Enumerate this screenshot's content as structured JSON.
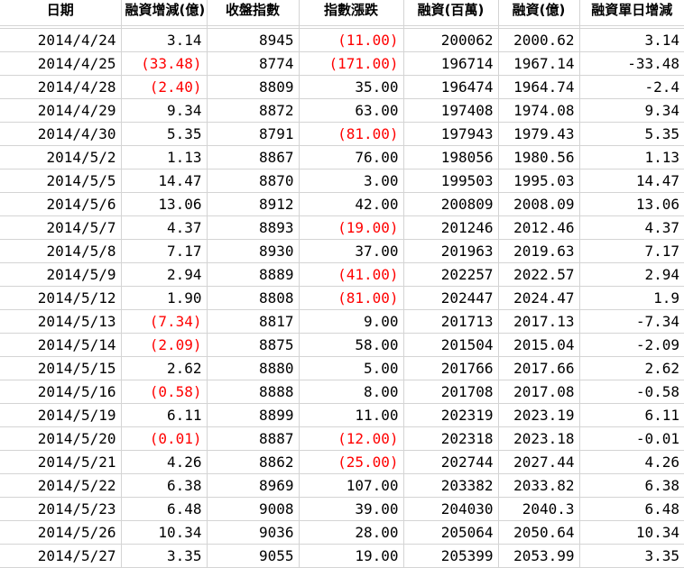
{
  "colors": {
    "negative": "#ff0000",
    "gridline": "#d4d4d4"
  },
  "headers": [
    "日期",
    "融資增減(億)",
    "收盤指數",
    "指數漲跌",
    "融資(百萬)",
    "融資(億)",
    "融資單日增減"
  ],
  "rows": [
    [
      "2014/4/24",
      "3.14",
      "8945",
      "(11.00)",
      "200062",
      "2000.62",
      "3.14"
    ],
    [
      "2014/4/25",
      "(33.48)",
      "8774",
      "(171.00)",
      "196714",
      "1967.14",
      "-33.48"
    ],
    [
      "2014/4/28",
      "(2.40)",
      "8809",
      "35.00",
      "196474",
      "1964.74",
      "-2.4"
    ],
    [
      "2014/4/29",
      "9.34",
      "8872",
      "63.00",
      "197408",
      "1974.08",
      "9.34"
    ],
    [
      "2014/4/30",
      "5.35",
      "8791",
      "(81.00)",
      "197943",
      "1979.43",
      "5.35"
    ],
    [
      "2014/5/2",
      "1.13",
      "8867",
      "76.00",
      "198056",
      "1980.56",
      "1.13"
    ],
    [
      "2014/5/5",
      "14.47",
      "8870",
      "3.00",
      "199503",
      "1995.03",
      "14.47"
    ],
    [
      "2014/5/6",
      "13.06",
      "8912",
      "42.00",
      "200809",
      "2008.09",
      "13.06"
    ],
    [
      "2014/5/7",
      "4.37",
      "8893",
      "(19.00)",
      "201246",
      "2012.46",
      "4.37"
    ],
    [
      "2014/5/8",
      "7.17",
      "8930",
      "37.00",
      "201963",
      "2019.63",
      "7.17"
    ],
    [
      "2014/5/9",
      "2.94",
      "8889",
      "(41.00)",
      "202257",
      "2022.57",
      "2.94"
    ],
    [
      "2014/5/12",
      "1.90",
      "8808",
      "(81.00)",
      "202447",
      "2024.47",
      "1.9"
    ],
    [
      "2014/5/13",
      "(7.34)",
      "8817",
      "9.00",
      "201713",
      "2017.13",
      "-7.34"
    ],
    [
      "2014/5/14",
      "(2.09)",
      "8875",
      "58.00",
      "201504",
      "2015.04",
      "-2.09"
    ],
    [
      "2014/5/15",
      "2.62",
      "8880",
      "5.00",
      "201766",
      "2017.66",
      "2.62"
    ],
    [
      "2014/5/16",
      "(0.58)",
      "8888",
      "8.00",
      "201708",
      "2017.08",
      "-0.58"
    ],
    [
      "2014/5/19",
      "6.11",
      "8899",
      "11.00",
      "202319",
      "2023.19",
      "6.11"
    ],
    [
      "2014/5/20",
      "(0.01)",
      "8887",
      "(12.00)",
      "202318",
      "2023.18",
      "-0.01"
    ],
    [
      "2014/5/21",
      "4.26",
      "8862",
      "(25.00)",
      "202744",
      "2027.44",
      "4.26"
    ],
    [
      "2014/5/22",
      "6.38",
      "8969",
      "107.00",
      "203382",
      "2033.82",
      "6.38"
    ],
    [
      "2014/5/23",
      "6.48",
      "9008",
      "39.00",
      "204030",
      "2040.3",
      "6.48"
    ],
    [
      "2014/5/26",
      "10.34",
      "9036",
      "28.00",
      "205064",
      "2050.64",
      "10.34"
    ],
    [
      "2014/5/27",
      "3.35",
      "9055",
      "19.00",
      "205399",
      "2053.99",
      "3.35"
    ]
  ]
}
